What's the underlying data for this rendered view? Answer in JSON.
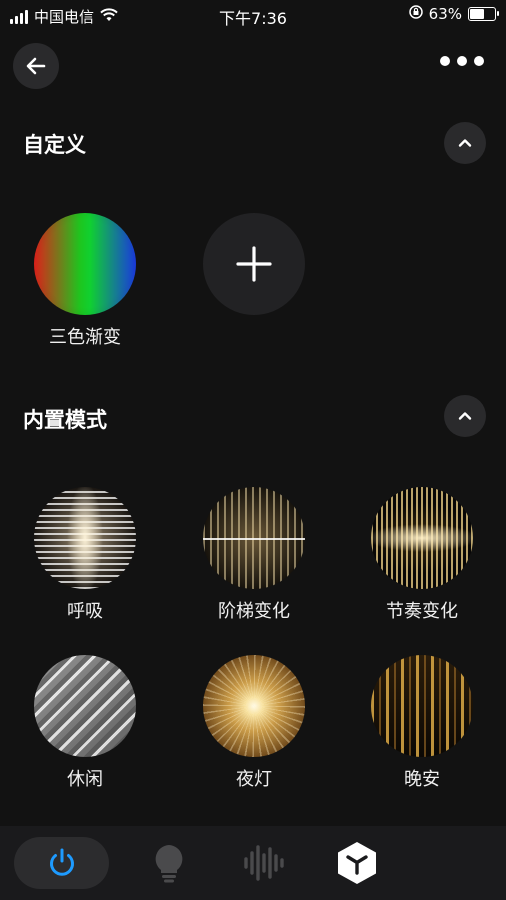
{
  "status_bar": {
    "carrier": "中国电信",
    "time": "下午7:36",
    "battery": "63%",
    "battery_level": 0.63
  },
  "header": {
    "back_icon": "back-arrow-icon",
    "more_icon": "more-dots-icon"
  },
  "custom_section": {
    "title": "自定义",
    "items": [
      {
        "label": "三色渐变",
        "icon": "rgb-gradient"
      }
    ],
    "add_icon": "plus-icon"
  },
  "builtin_section": {
    "title": "内置模式",
    "items": [
      {
        "label": "呼吸",
        "icon": "breath-mode"
      },
      {
        "label": "阶梯变化",
        "icon": "stairs-mode"
      },
      {
        "label": "节奏变化",
        "icon": "rhythm-mode"
      },
      {
        "label": "休闲",
        "icon": "leisure-mode"
      },
      {
        "label": "夜灯",
        "icon": "nightlight-mode"
      },
      {
        "label": "晚安",
        "icon": "evening-mode"
      }
    ]
  },
  "tabbar": {
    "tabs": [
      {
        "icon": "power-icon",
        "active": true,
        "color": "#1e9bff"
      },
      {
        "icon": "bulb-icon",
        "active": false
      },
      {
        "icon": "sound-wave-icon",
        "active": false
      },
      {
        "icon": "cube-icon",
        "active": false
      }
    ]
  }
}
